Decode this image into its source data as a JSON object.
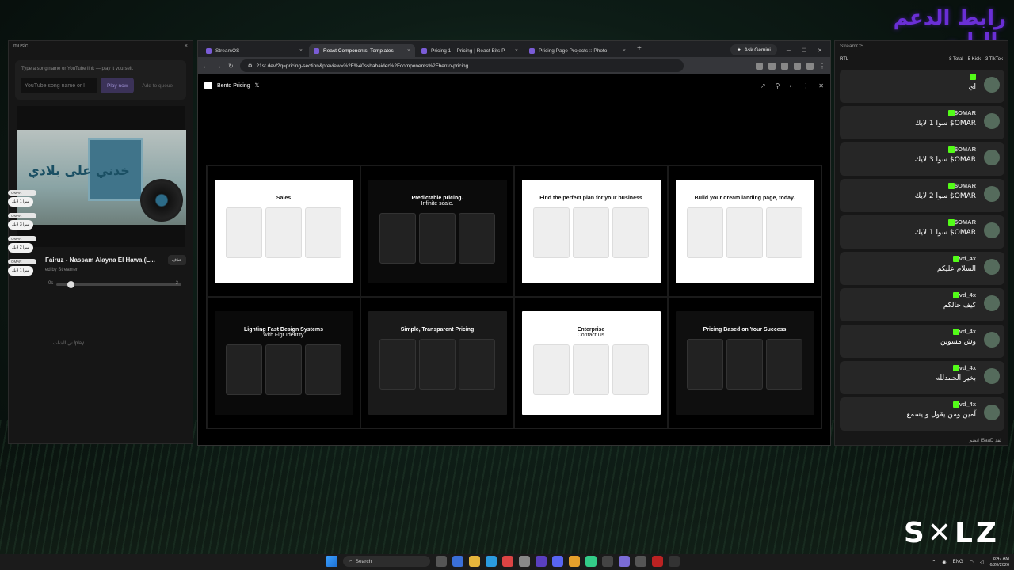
{
  "banner": {
    "text": "رابط الدعم بالبايو"
  },
  "music": {
    "panel_title": "music",
    "hint": "Type a song name or YouTube link — play it yourself.",
    "input_placeholder": "YouTube song name or l",
    "play_label": "Play now",
    "queue_label": "Add to queue",
    "cover_text": "خدني على بلادي",
    "track_title": "Fairuz - Nassam Alayna El Hawa (L...",
    "track_sub": "ed by Streamer",
    "delete_label": "حذف",
    "time_left": "0s",
    "time_right": "2",
    "playlist_hint": "تي الشات !play ..."
  },
  "overlay_chat": [
    {
      "name": "OMAR",
      "text": "سوا 1 لايك"
    },
    {
      "name": "OMAR",
      "text": "سوا 3 لايك"
    },
    {
      "name": "OMAR",
      "text": "سوا 2 لايك"
    },
    {
      "name": "OMAR",
      "text": "سوا 1 لايك"
    }
  ],
  "browser": {
    "tabs": [
      {
        "label": "StreamOS",
        "active": false
      },
      {
        "label": "React Components, Templates",
        "active": true
      },
      {
        "label": "Pricing 1 – Pricing | React Bits P",
        "active": false
      },
      {
        "label": "Pricing Page Projects :: Photo",
        "active": false
      }
    ],
    "new_tab": "+",
    "gemini": "Ask Gemini",
    "url": "21st.dev/?q=pricing-section&preview=%2F%40sshahaider%2Fcomponents%2Fbento-pricing",
    "page_title": "Bento Pricing",
    "x_icon": "𝕏"
  },
  "bento": [
    {
      "title": "Sales",
      "sub": "",
      "bg": "#ffffff",
      "fg": "#111111"
    },
    {
      "title": "Predictable pricing.",
      "sub": "Infinite scale.",
      "bg": "#0b0b0b",
      "fg": "#ffffff"
    },
    {
      "title": "Find the perfect plan for your business",
      "sub": "",
      "bg": "#ffffff",
      "fg": "#111111"
    },
    {
      "title": "Build your dream landing page, today.",
      "sub": "",
      "bg": "#ffffff",
      "fg": "#111111"
    },
    {
      "title": "Lighting Fast Design Systems",
      "sub": "with Figr Identity",
      "bg": "#0a0a0a",
      "fg": "#ffffff"
    },
    {
      "title": "Simple, Transparent Pricing",
      "sub": "",
      "bg": "#1a1a1a",
      "fg": "#ffffff"
    },
    {
      "title": "Enterprise",
      "sub": "Contact Us",
      "bg": "#ffffff",
      "fg": "#111111"
    },
    {
      "title": "Pricing Based on Your Success",
      "sub": "",
      "bg": "#0f0f0f",
      "fg": "#ffffff"
    }
  ],
  "chat": {
    "panel_title": "StreamOS",
    "rtl_label": "RTL",
    "counts": {
      "total": "8 Total",
      "kick": "5 Kick",
      "tiktok": "3 TikTok"
    },
    "messages": [
      {
        "user": "",
        "text": "اي"
      },
      {
        "user": "OMAR$",
        "text": "OMAR$ سوا 1 لايك"
      },
      {
        "user": "OMAR$",
        "text": "OMAR$ سوا 3 لايك"
      },
      {
        "user": "OMAR$",
        "text": "OMAR$ سوا 2 لايك"
      },
      {
        "user": "OMAR$",
        "text": "OMAR$ سوا 1 لايك"
      },
      {
        "user": "vd_4x",
        "text": "السلام عليكم"
      },
      {
        "user": "vd_4x",
        "text": "كيف حالكم"
      },
      {
        "user": "vd_4x",
        "text": "وش مسوين"
      },
      {
        "user": "vd_4x",
        "text": "بخير الحمدلله"
      },
      {
        "user": "vd_4x",
        "text": "آمين ومن يقول و يسمع"
      }
    ],
    "footer": "انضم ISaaD لقد"
  },
  "brand": {
    "logo": "S✕LZ"
  },
  "taskbar": {
    "search": "Search",
    "time": "8:47 AM",
    "date": "6/20/2026",
    "lang": "ENG"
  }
}
